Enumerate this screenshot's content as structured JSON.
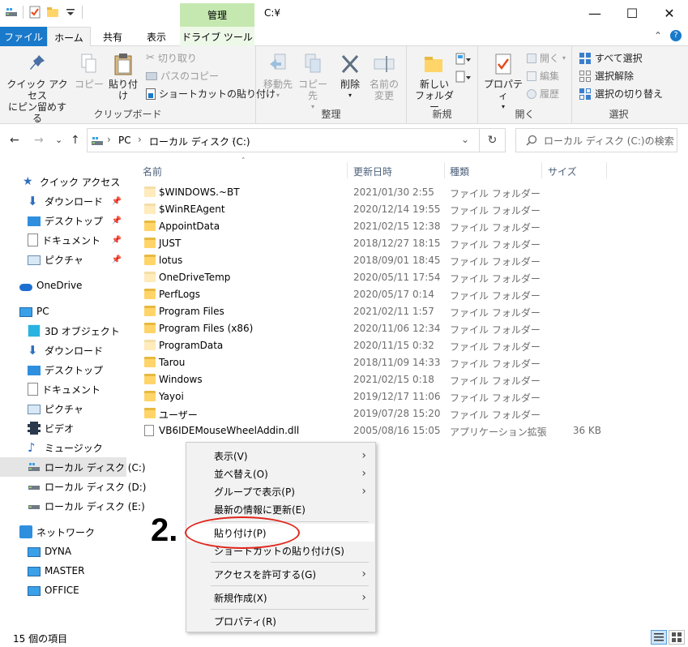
{
  "window": {
    "title": "C:¥",
    "context_tab_group": "管理",
    "controls": {
      "minimize": "—",
      "maximize": "☐",
      "close": "✕"
    }
  },
  "tabs": {
    "file": "ファイル",
    "home": "ホーム",
    "share": "共有",
    "view": "表示",
    "drive_tools": "ドライブ ツール",
    "collapse_glyph": "⌃",
    "help_glyph": "?"
  },
  "ribbon": {
    "clipboard": {
      "label": "クリップボード",
      "pin_quick_access_line1": "クイック アクセス",
      "pin_quick_access_line2": "にピン留めする",
      "copy": "コピー",
      "paste": "貼り付け",
      "cut": "切り取り",
      "copy_path": "パスのコピー",
      "paste_shortcut": "ショートカットの貼り付け"
    },
    "organize": {
      "label": "整理",
      "move_to": "移動先",
      "copy_to": "コピー先",
      "delete": "削除",
      "rename_line1": "名前の",
      "rename_line2": "変更"
    },
    "new": {
      "label": "新規",
      "new_folder_line1": "新しい",
      "new_folder_line2": "フォルダー"
    },
    "open": {
      "label": "開く",
      "properties": "プロパティ",
      "open": "開く",
      "edit": "編集",
      "history": "履歴"
    },
    "select": {
      "label": "選択",
      "select_all": "すべて選択",
      "select_none": "選択解除",
      "invert": "選択の切り替え"
    }
  },
  "addressbar": {
    "back": "←",
    "forward": "→",
    "recent": "⌄",
    "up": "↑",
    "crumbs": [
      "PC",
      "ローカル ディスク (C:)"
    ],
    "separator": "›",
    "refresh": "↻",
    "search_placeholder": "ローカル ディスク (C:)の検索"
  },
  "navpane": {
    "quick_access": "クイック アクセス",
    "qa_items": [
      "ダウンロード",
      "デスクトップ",
      "ドキュメント",
      "ピクチャ"
    ],
    "onedrive": "OneDrive",
    "pc": "PC",
    "pc_items": [
      "3D オブジェクト",
      "ダウンロード",
      "デスクトップ",
      "ドキュメント",
      "ピクチャ",
      "ビデオ",
      "ミュージック",
      "ローカル ディスク (C:)",
      "ローカル ディスク (D:)",
      "ローカル ディスク (E:)"
    ],
    "network": "ネットワーク",
    "network_items": [
      "DYNA",
      "MASTER",
      "OFFICE"
    ]
  },
  "filelist": {
    "columns": {
      "name": "名前",
      "modified": "更新日時",
      "type": "種類",
      "size": "サイズ"
    },
    "rows": [
      {
        "name": "$WINDOWS.~BT",
        "modified": "2021/01/30 2:55",
        "type": "ファイル フォルダー",
        "size": ""
      },
      {
        "name": "$WinREAgent",
        "modified": "2020/12/14 19:55",
        "type": "ファイル フォルダー",
        "size": ""
      },
      {
        "name": "AppointData",
        "modified": "2021/02/15 12:38",
        "type": "ファイル フォルダー",
        "size": ""
      },
      {
        "name": "JUST",
        "modified": "2018/12/27 18:15",
        "type": "ファイル フォルダー",
        "size": ""
      },
      {
        "name": "lotus",
        "modified": "2018/09/01 18:45",
        "type": "ファイル フォルダー",
        "size": ""
      },
      {
        "name": "OneDriveTemp",
        "modified": "2020/05/11 17:54",
        "type": "ファイル フォルダー",
        "size": ""
      },
      {
        "name": "PerfLogs",
        "modified": "2020/05/17 0:14",
        "type": "ファイル フォルダー",
        "size": ""
      },
      {
        "name": "Program Files",
        "modified": "2021/02/11 1:57",
        "type": "ファイル フォルダー",
        "size": ""
      },
      {
        "name": "Program Files (x86)",
        "modified": "2020/11/06 12:34",
        "type": "ファイル フォルダー",
        "size": ""
      },
      {
        "name": "ProgramData",
        "modified": "2020/11/15 0:32",
        "type": "ファイル フォルダー",
        "size": ""
      },
      {
        "name": "Tarou",
        "modified": "2018/11/09 14:33",
        "type": "ファイル フォルダー",
        "size": ""
      },
      {
        "name": "Windows",
        "modified": "2021/02/15 0:18",
        "type": "ファイル フォルダー",
        "size": ""
      },
      {
        "name": "Yayoi",
        "modified": "2019/12/17 11:06",
        "type": "ファイル フォルダー",
        "size": ""
      },
      {
        "name": "ユーザー",
        "modified": "2019/07/28 15:20",
        "type": "ファイル フォルダー",
        "size": ""
      },
      {
        "name": "VB6IDEMouseWheelAddin.dll",
        "modified": "2005/08/16 15:05",
        "type": "アプリケーション拡張",
        "size": "36 KB"
      }
    ]
  },
  "context_menu": {
    "view": "表示(V)",
    "sort": "並べ替え(O)",
    "group": "グループで表示(P)",
    "refresh": "最新の情報に更新(E)",
    "paste": "貼り付け(P)",
    "paste_shortcut": "ショートカットの貼り付け(S)",
    "grant_access": "アクセスを許可する(G)",
    "new": "新規作成(X)",
    "properties": "プロパティ(R)",
    "submenu_arrow": "›"
  },
  "annotation": {
    "step": "2."
  },
  "statusbar": {
    "count": "15 個の項目"
  },
  "colors": {
    "accent": "#1979ca",
    "folder": "#ffd56a",
    "context_tab": "#c5e8b0",
    "annotation_red": "#e0251b"
  }
}
